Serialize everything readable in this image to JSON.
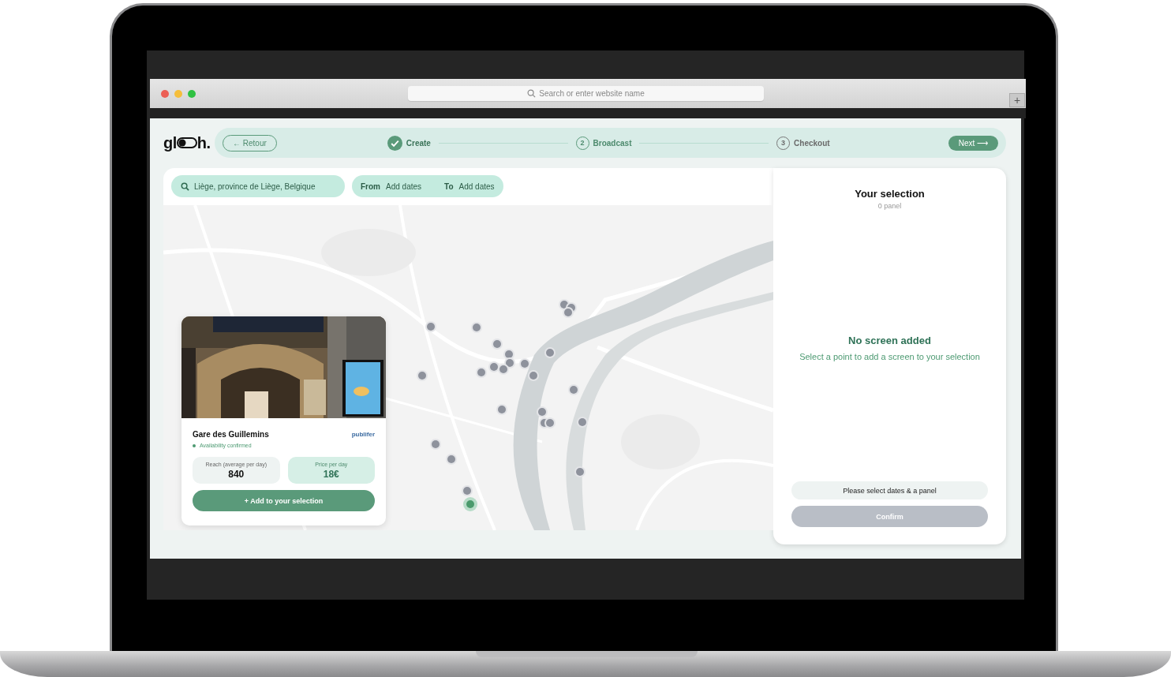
{
  "browser": {
    "url_placeholder": "Search or enter website name",
    "new_tab": "+"
  },
  "logo": {
    "before": "gl",
    "after": "h."
  },
  "back_button": {
    "arrow": "←",
    "label": "Retour"
  },
  "steps": [
    {
      "label": "Create",
      "done": true,
      "selected": false
    },
    {
      "number": "2",
      "label": "Broadcast",
      "done": false,
      "selected": true
    },
    {
      "number": "3",
      "label": "Checkout",
      "done": false,
      "selected": false
    }
  ],
  "next_button": {
    "label": "Next",
    "arrow": "⟶"
  },
  "search": {
    "value": "Liège, province de Liège, Belgique"
  },
  "dates": {
    "from_label": "From",
    "from_value": "Add dates",
    "to_label": "To",
    "to_value": "Add dates"
  },
  "map": {
    "markers": [
      {
        "selected": false
      },
      {
        "selected": false
      },
      {
        "selected": false
      },
      {
        "selected": false
      },
      {
        "selected": false
      },
      {
        "selected": false
      },
      {
        "selected": false
      },
      {
        "selected": false
      },
      {
        "selected": false
      },
      {
        "selected": false
      },
      {
        "selected": false
      },
      {
        "selected": false
      },
      {
        "selected": false
      },
      {
        "selected": false
      },
      {
        "selected": false
      },
      {
        "selected": false
      },
      {
        "selected": false
      },
      {
        "selected": false
      },
      {
        "selected": false
      },
      {
        "selected": false
      },
      {
        "selected": false
      },
      {
        "selected": false
      },
      {
        "selected": false
      },
      {
        "selected": false
      },
      {
        "selected": false
      },
      {
        "selected": true
      }
    ]
  },
  "screen_card": {
    "name": "Gare des Guillemins",
    "availability": "Availability confirmed",
    "provider": "publifer",
    "reach_label": "Reach (average per day)",
    "reach_value": "840",
    "price_label": "Price per day",
    "price_value": "18€",
    "add_button": "+ Add to your selection"
  },
  "selection": {
    "title": "Your selection",
    "count": "0 panel",
    "empty_title": "No screen added",
    "empty_text": "Select a point to add a screen to your selection",
    "notice": "Please select dates & a panel",
    "confirm": {
      "label": "Confirm",
      "disabled": true
    }
  }
}
